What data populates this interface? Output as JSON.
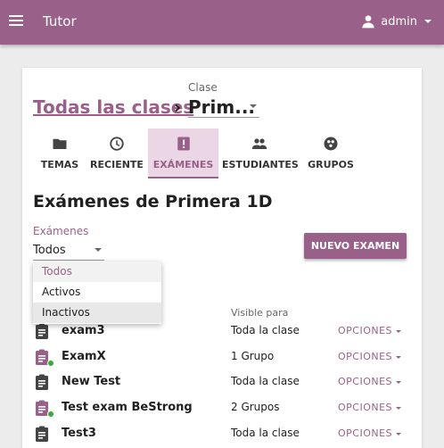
{
  "colors": {
    "brand": "#996189",
    "brand_light": "#ead6e5",
    "active_dot": "#3aa93a"
  },
  "appbar": {
    "title": "Tutor",
    "user": "admin",
    "menu_icon": "hamburger-menu-icon",
    "user_icon": "person-icon"
  },
  "breadcrumb": {
    "link": "Todas las clases",
    "separator": "›",
    "class_label": "Clase",
    "class_value": "Prim..."
  },
  "tabs": [
    {
      "label": "TEMAS",
      "icon": "folder-icon",
      "active": false
    },
    {
      "label": "RECIENTE",
      "icon": "clock-icon",
      "active": false
    },
    {
      "label": "EXÁMENES",
      "icon": "exam-alert-icon",
      "active": true
    },
    {
      "label": "ESTUDIANTES",
      "icon": "people-icon",
      "active": false
    },
    {
      "label": "GRUPOS",
      "icon": "groups-icon",
      "active": false
    }
  ],
  "heading": "Exámenes de Primera 1D",
  "filter": {
    "label": "Exámenes",
    "value": "Todos",
    "options": [
      "Todos",
      "Activos",
      "Inactivos"
    ]
  },
  "new_button": "NUEVO EXAMEN",
  "table": {
    "visible_header": "Visible para",
    "options_label": "OPCIONES",
    "rows": [
      {
        "title": "exam3",
        "visible": "Toda la clase",
        "active": false
      },
      {
        "title": "ExamX",
        "visible": "1 Grupo",
        "active": true
      },
      {
        "title": "New Test",
        "visible": "Toda la clase",
        "active": false
      },
      {
        "title": "Test exam BeStrong",
        "visible": "2 Grupos",
        "active": true
      },
      {
        "title": "Test3",
        "visible": "Toda la clase",
        "active": false
      }
    ]
  }
}
